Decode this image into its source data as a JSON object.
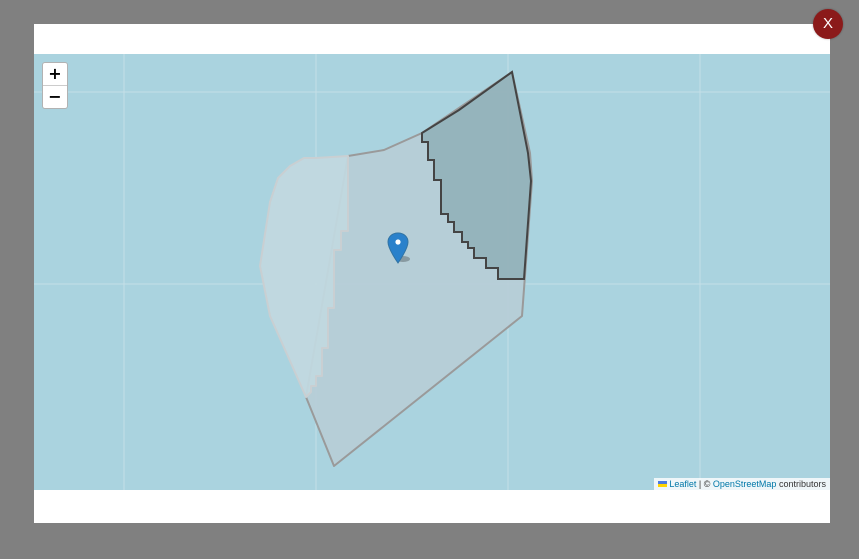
{
  "close_button": {
    "label": "X"
  },
  "zoom": {
    "in_label": "+",
    "out_label": "−"
  },
  "attribution": {
    "leaflet_label": "Leaflet",
    "separator": "| ©",
    "osm_label": "OpenStreetMap",
    "contributors": "contributors"
  },
  "colors": {
    "overlay": "#808080",
    "water": "#aad3df",
    "close": "#8b1a1a",
    "marker": "#2a81cb",
    "link": "#0078a8",
    "region_outline": "#444444"
  },
  "map": {
    "markers": [
      {
        "icon": "map-pin-icon",
        "color": "#2a81cb"
      }
    ],
    "regions": [
      {
        "name": "light-region",
        "style": "outline-light"
      },
      {
        "name": "main-region",
        "style": "outline-gray"
      },
      {
        "name": "highlighted-region",
        "style": "outline-dark"
      }
    ]
  }
}
